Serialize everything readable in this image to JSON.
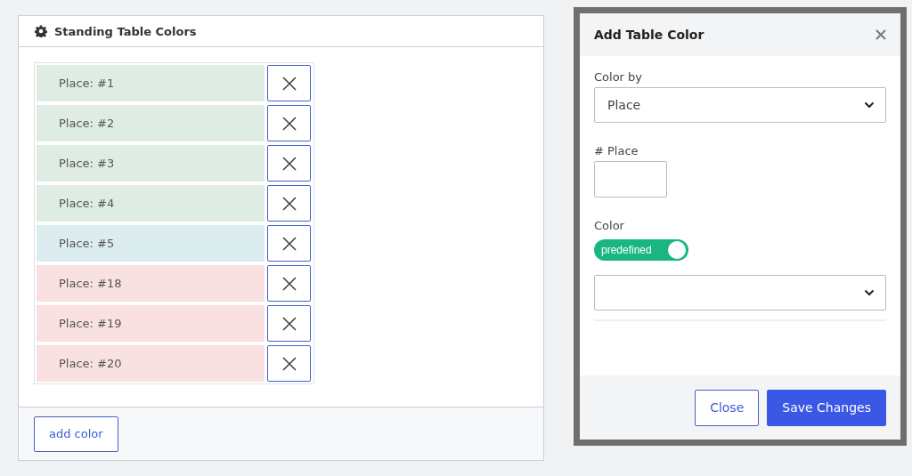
{
  "panel": {
    "title": "Standing Table Colors",
    "rows": [
      {
        "label": "Place: #1",
        "color": "#dfece3"
      },
      {
        "label": "Place: #2",
        "color": "#dfece3"
      },
      {
        "label": "Place: #3",
        "color": "#dfece3"
      },
      {
        "label": "Place: #4",
        "color": "#dfece3"
      },
      {
        "label": "Place: #5",
        "color": "#dcedf0"
      },
      {
        "label": "Place: #18",
        "color": "#f9e0e1"
      },
      {
        "label": "Place: #19",
        "color": "#f9e0e1"
      },
      {
        "label": "Place: #20",
        "color": "#f9e0e1"
      }
    ],
    "add_button": "add color"
  },
  "dialog": {
    "title": "Add Table Color",
    "color_by": {
      "label": "Color by",
      "value": "Place"
    },
    "place": {
      "label": "# Place"
    },
    "color": {
      "label": "Color",
      "toggle": {
        "label": "predefined",
        "on": true
      }
    },
    "buttons": [
      {
        "label": "Close",
        "kind": "secondary"
      },
      {
        "label": "Save Changes",
        "kind": "primary"
      }
    ]
  }
}
